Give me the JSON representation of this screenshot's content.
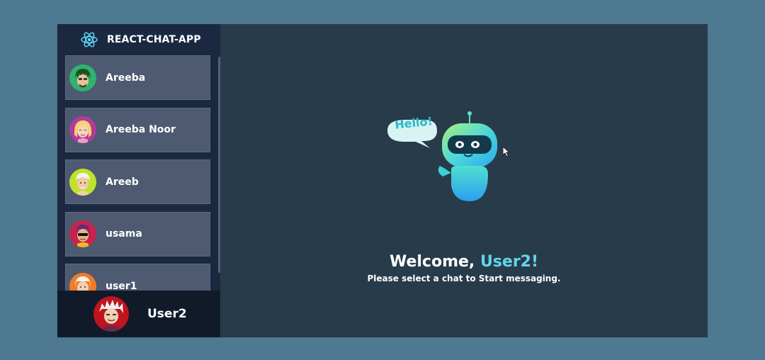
{
  "app": {
    "title": "REACT-CHAT-APP",
    "logo_icon": "react-logo-icon",
    "accent_color": "#63d4ec"
  },
  "sidebar": {
    "contacts": [
      {
        "name": "Areeba",
        "avatar": "avatar-green-dreadlocks"
      },
      {
        "name": "Areeba Noor",
        "avatar": "avatar-blonde-girl"
      },
      {
        "name": "Areeb",
        "avatar": "avatar-old-man"
      },
      {
        "name": "usama",
        "avatar": "avatar-sunglasses"
      },
      {
        "name": "user1",
        "avatar": "avatar-orange-white-hair"
      }
    ]
  },
  "current_user": {
    "name": "User2",
    "avatar": "avatar-red-white-hair"
  },
  "main": {
    "bot_bubble_text": "Hello!",
    "welcome_prefix": "Welcome, ",
    "welcome_name": "User2!",
    "subtitle": "Please select a chat to Start messaging."
  }
}
